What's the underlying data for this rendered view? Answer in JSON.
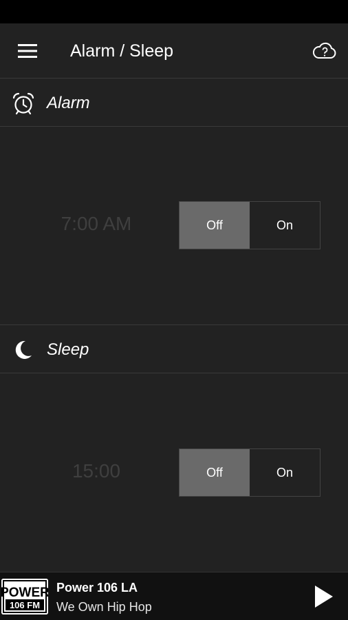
{
  "app_bar": {
    "title": "Alarm / Sleep",
    "menu_icon": "hamburger-menu-icon",
    "action_icon": "cloud-help-icon"
  },
  "alarm": {
    "icon": "alarm-clock-icon",
    "label": "Alarm",
    "time": "7:00 AM",
    "toggle": {
      "off_label": "Off",
      "on_label": "On",
      "selected": "Off"
    }
  },
  "sleep": {
    "icon": "crescent-moon-icon",
    "label": "Sleep",
    "time": "15:00",
    "toggle": {
      "off_label": "Off",
      "on_label": "On",
      "selected": "Off"
    }
  },
  "player": {
    "logo_text_top": "POWER",
    "logo_text_bottom": "106 FM",
    "station_name": "Power 106 LA",
    "tagline": "We Own Hip Hop",
    "play_icon": "play-icon"
  },
  "colors": {
    "background": "#222222",
    "status_bar": "#000000",
    "toggle_active": "#6a6a6a",
    "time_text": "#3f3f3f"
  }
}
